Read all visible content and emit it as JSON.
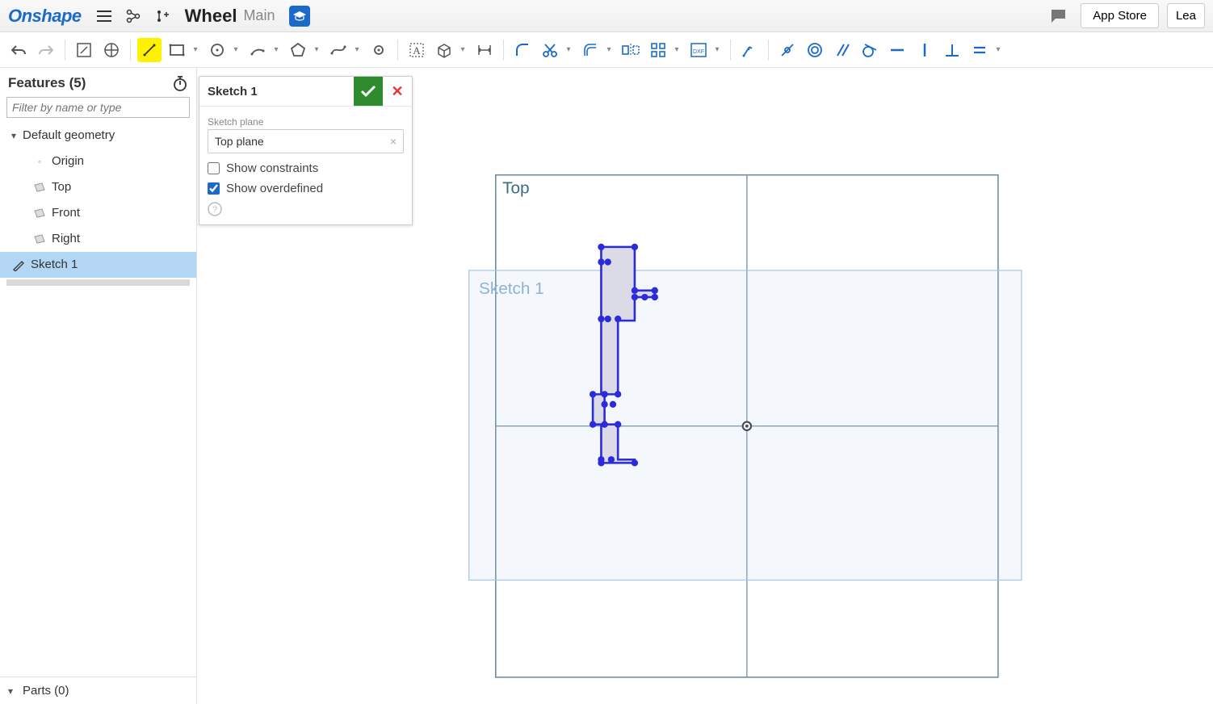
{
  "header": {
    "logo": "Onshape",
    "doc_title": "Wheel",
    "doc_sub": "Main",
    "app_store": "App Store",
    "learn": "Lea"
  },
  "sidebar": {
    "features_title": "Features (5)",
    "filter_placeholder": "Filter by name or type",
    "default_geometry": "Default geometry",
    "items": {
      "origin": "Origin",
      "top": "Top",
      "front": "Front",
      "right": "Right",
      "sketch": "Sketch 1"
    },
    "parts_title": "Parts (0)"
  },
  "dialog": {
    "title": "Sketch 1",
    "plane_label": "Sketch plane",
    "plane_value": "Top plane",
    "show_constraints": "Show constraints",
    "show_overdefined": "Show overdefined"
  },
  "canvas": {
    "top_label": "Top",
    "sketch_label": "Sketch 1"
  }
}
